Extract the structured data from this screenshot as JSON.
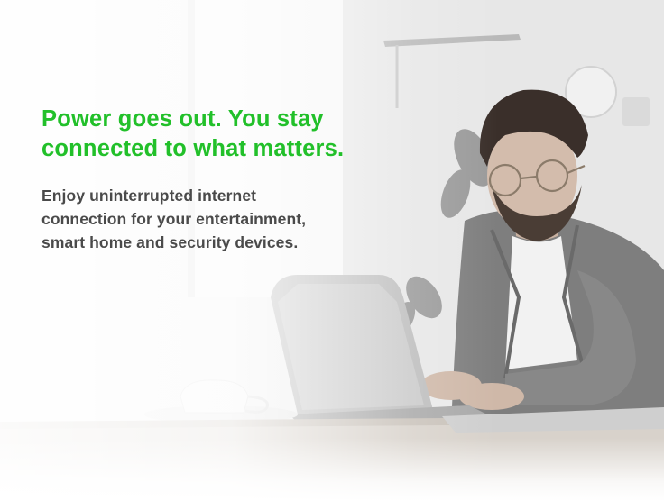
{
  "banner": {
    "headline_lines": [
      "Power goes out. You stay",
      "connected to what matters."
    ],
    "subtext_lines": [
      "Enjoy uninterrupted internet",
      "connection for your entertainment,",
      "smart home and security devices."
    ],
    "colors": {
      "headline": "#22c02a",
      "subtext": "#4a4a4a"
    },
    "image": {
      "icon": "man-working-on-laptop-photo"
    }
  }
}
